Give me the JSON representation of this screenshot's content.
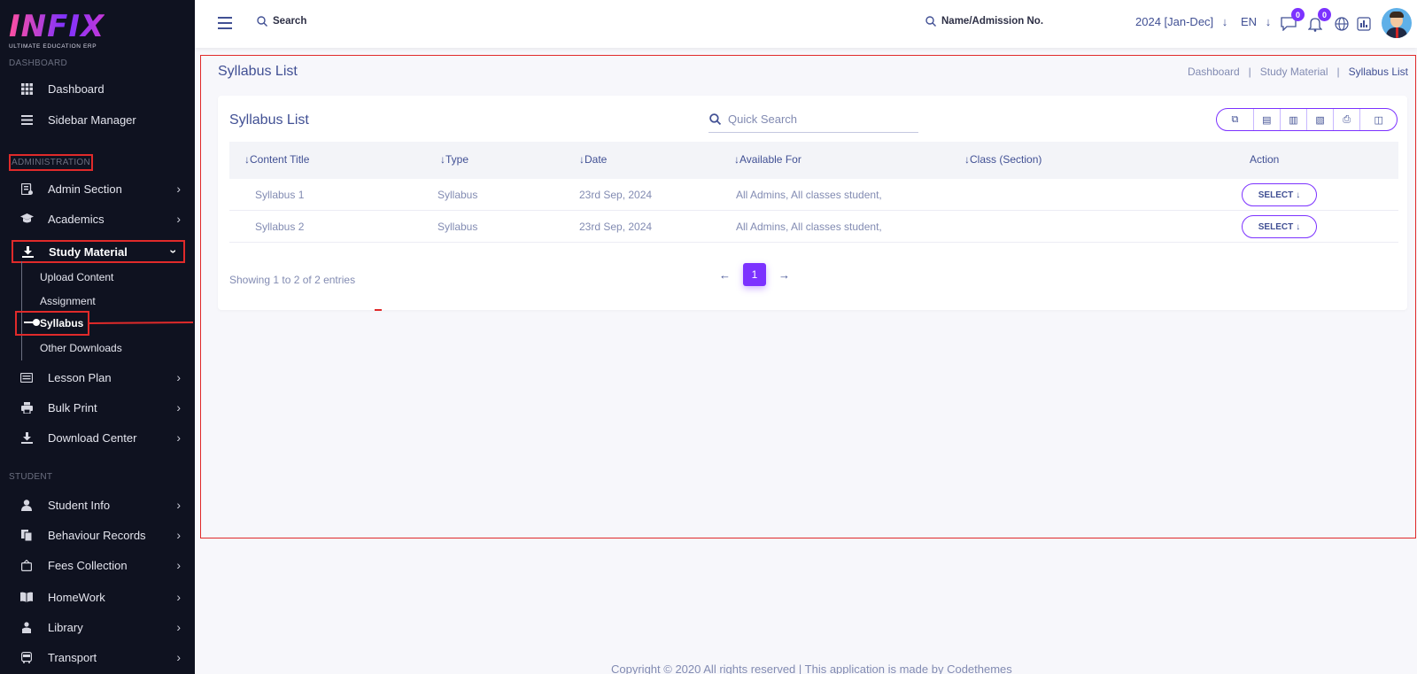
{
  "brand": {
    "name": "INFIX",
    "tagline": "ULTIMATE EDUCATION ERP"
  },
  "sidebar": {
    "section_dashboard": "DASHBOARD",
    "section_administration": "ADMINISTRATION",
    "section_student": "STUDENT",
    "top_items": [
      {
        "label": "Dashboard",
        "icon": "grid-icon"
      },
      {
        "label": "Sidebar Manager",
        "icon": "list-icon"
      }
    ],
    "admin_items": [
      {
        "label": "Admin Section",
        "icon": "admin-icon"
      },
      {
        "label": "Academics",
        "icon": "graduation-cap-icon"
      },
      {
        "label": "Study Material",
        "icon": "download-icon"
      },
      {
        "label": "Lesson Plan",
        "icon": "book-icon"
      },
      {
        "label": "Bulk Print",
        "icon": "printer-icon"
      },
      {
        "label": "Download Center",
        "icon": "download-icon"
      }
    ],
    "study_sub_items": [
      "Upload Content",
      "Assignment",
      "Syllabus",
      "Other Downloads"
    ],
    "student_items": [
      {
        "label": "Student Info",
        "icon": "user-icon"
      },
      {
        "label": "Behaviour Records",
        "icon": "records-icon"
      },
      {
        "label": "Fees Collection",
        "icon": "fees-icon"
      },
      {
        "label": "HomeWork",
        "icon": "home-icon"
      },
      {
        "label": "Library",
        "icon": "library-icon"
      },
      {
        "label": "Transport",
        "icon": "bus-icon"
      }
    ]
  },
  "header": {
    "search_label": "Search",
    "student_search_label": "Name/Admission No.",
    "year": "2024 [Jan-Dec]",
    "language": "EN",
    "chat_badge": "0",
    "notification_badge": "0"
  },
  "page": {
    "title": "Syllabus List",
    "breadcrumb": [
      "Dashboard",
      "Study Material",
      "Syllabus List"
    ]
  },
  "card": {
    "title": "Syllabus List",
    "quick_search_placeholder": "Quick Search",
    "columns": [
      "Content Title",
      "Type",
      "Date",
      "Available For",
      "Class (Section)",
      "Action"
    ],
    "rows": [
      {
        "title": "Syllabus 1",
        "type": "Syllabus",
        "date": "23rd Sep, 2024",
        "available_for": "All Admins, All classes student,",
        "class_section": "",
        "action": "SELECT"
      },
      {
        "title": "Syllabus 2",
        "type": "Syllabus",
        "date": "23rd Sep, 2024",
        "available_for": "All Admins, All classes student,",
        "class_section": "",
        "action": "SELECT"
      }
    ],
    "showing_text": "Showing 1 to 2 of 2 entries",
    "current_page": "1"
  },
  "footer": {
    "text": "Copyright © 2020 All rights reserved | This application is made by Codethemes"
  },
  "colors": {
    "accent": "#7c32ff",
    "highlight_red": "#e02a2a",
    "sidebar_bg": "#0f1220",
    "text_primary": "#415094"
  }
}
